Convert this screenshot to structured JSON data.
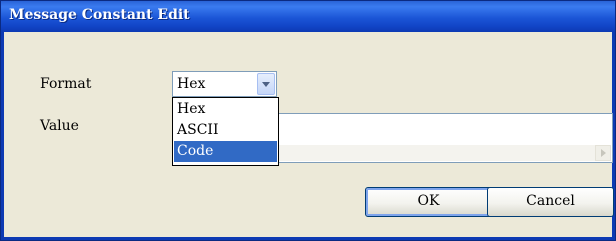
{
  "window": {
    "title": "Message Constant Edit"
  },
  "form": {
    "format_label": "Format",
    "format_value": "Hex",
    "value_label": "Value",
    "value_text": ""
  },
  "dropdown": {
    "options": [
      "Hex",
      "ASCII",
      "Code"
    ],
    "highlighted": "Code"
  },
  "buttons": {
    "ok": "OK",
    "cancel": "Cancel"
  },
  "colors": {
    "title_bar": "#1b55d6",
    "dialog_bg": "#ece9d8",
    "selection": "#316ac5"
  }
}
